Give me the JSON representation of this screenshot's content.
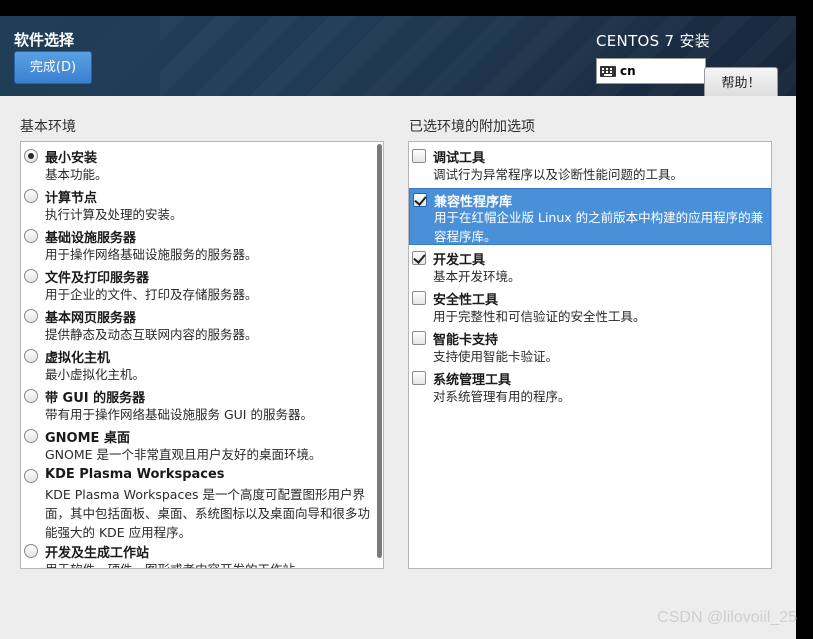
{
  "header": {
    "title": "软件选择",
    "done_button": "完成(D)",
    "product": "CENTOS 7 安装",
    "keyboard_layout": "cn",
    "help_button": "帮助！"
  },
  "base_env": {
    "title": "基本环境",
    "items": [
      {
        "name": "最小安装",
        "desc": "基本功能。",
        "selected": true
      },
      {
        "name": "计算节点",
        "desc": "执行计算及处理的安装。",
        "selected": false
      },
      {
        "name": "基础设施服务器",
        "desc": "用于操作网络基础设施服务的服务器。",
        "selected": false
      },
      {
        "name": "文件及打印服务器",
        "desc": "用于企业的文件、打印及存储服务器。",
        "selected": false
      },
      {
        "name": "基本网页服务器",
        "desc": "提供静态及动态互联网内容的服务器。",
        "selected": false
      },
      {
        "name": "虚拟化主机",
        "desc": "最小虚拟化主机。",
        "selected": false
      },
      {
        "name": "带 GUI 的服务器",
        "desc": "带有用于操作网络基础设施服务 GUI 的服务器。",
        "selected": false
      },
      {
        "name": "GNOME 桌面",
        "desc": "GNOME 是一个非常直观且用户友好的桌面环境。",
        "selected": false
      },
      {
        "name": "KDE Plasma Workspaces",
        "desc": "KDE Plasma Workspaces 是一个高度可配置图形用户界面，其中包括面板、桌面、系统图标以及桌面向导和很多功能强大的 KDE 应用程序。",
        "selected": false
      },
      {
        "name": "开发及生成工作站",
        "desc": "用于软件、硬件、图形或者内容开发的工作站。",
        "selected": false
      }
    ]
  },
  "addons": {
    "title": "已选环境的附加选项",
    "items": [
      {
        "name": "调试工具",
        "desc": "调试行为异常程序以及诊断性能问题的工具。",
        "checked": false
      },
      {
        "name": "兼容性程序库",
        "desc": "用于在红帽企业版 Linux 的之前版本中构建的应用程序的兼容程序库。",
        "checked": true,
        "highlighted": true
      },
      {
        "name": "开发工具",
        "desc": "基本开发环境。",
        "checked": true
      },
      {
        "name": "安全性工具",
        "desc": "用于完整性和可信验证的安全性工具。",
        "checked": false
      },
      {
        "name": "智能卡支持",
        "desc": "支持使用智能卡验证。",
        "checked": false
      },
      {
        "name": "系统管理工具",
        "desc": "对系统管理有用的程序。",
        "checked": false
      }
    ]
  },
  "watermark": "CSDN @lilovoiil_25"
}
